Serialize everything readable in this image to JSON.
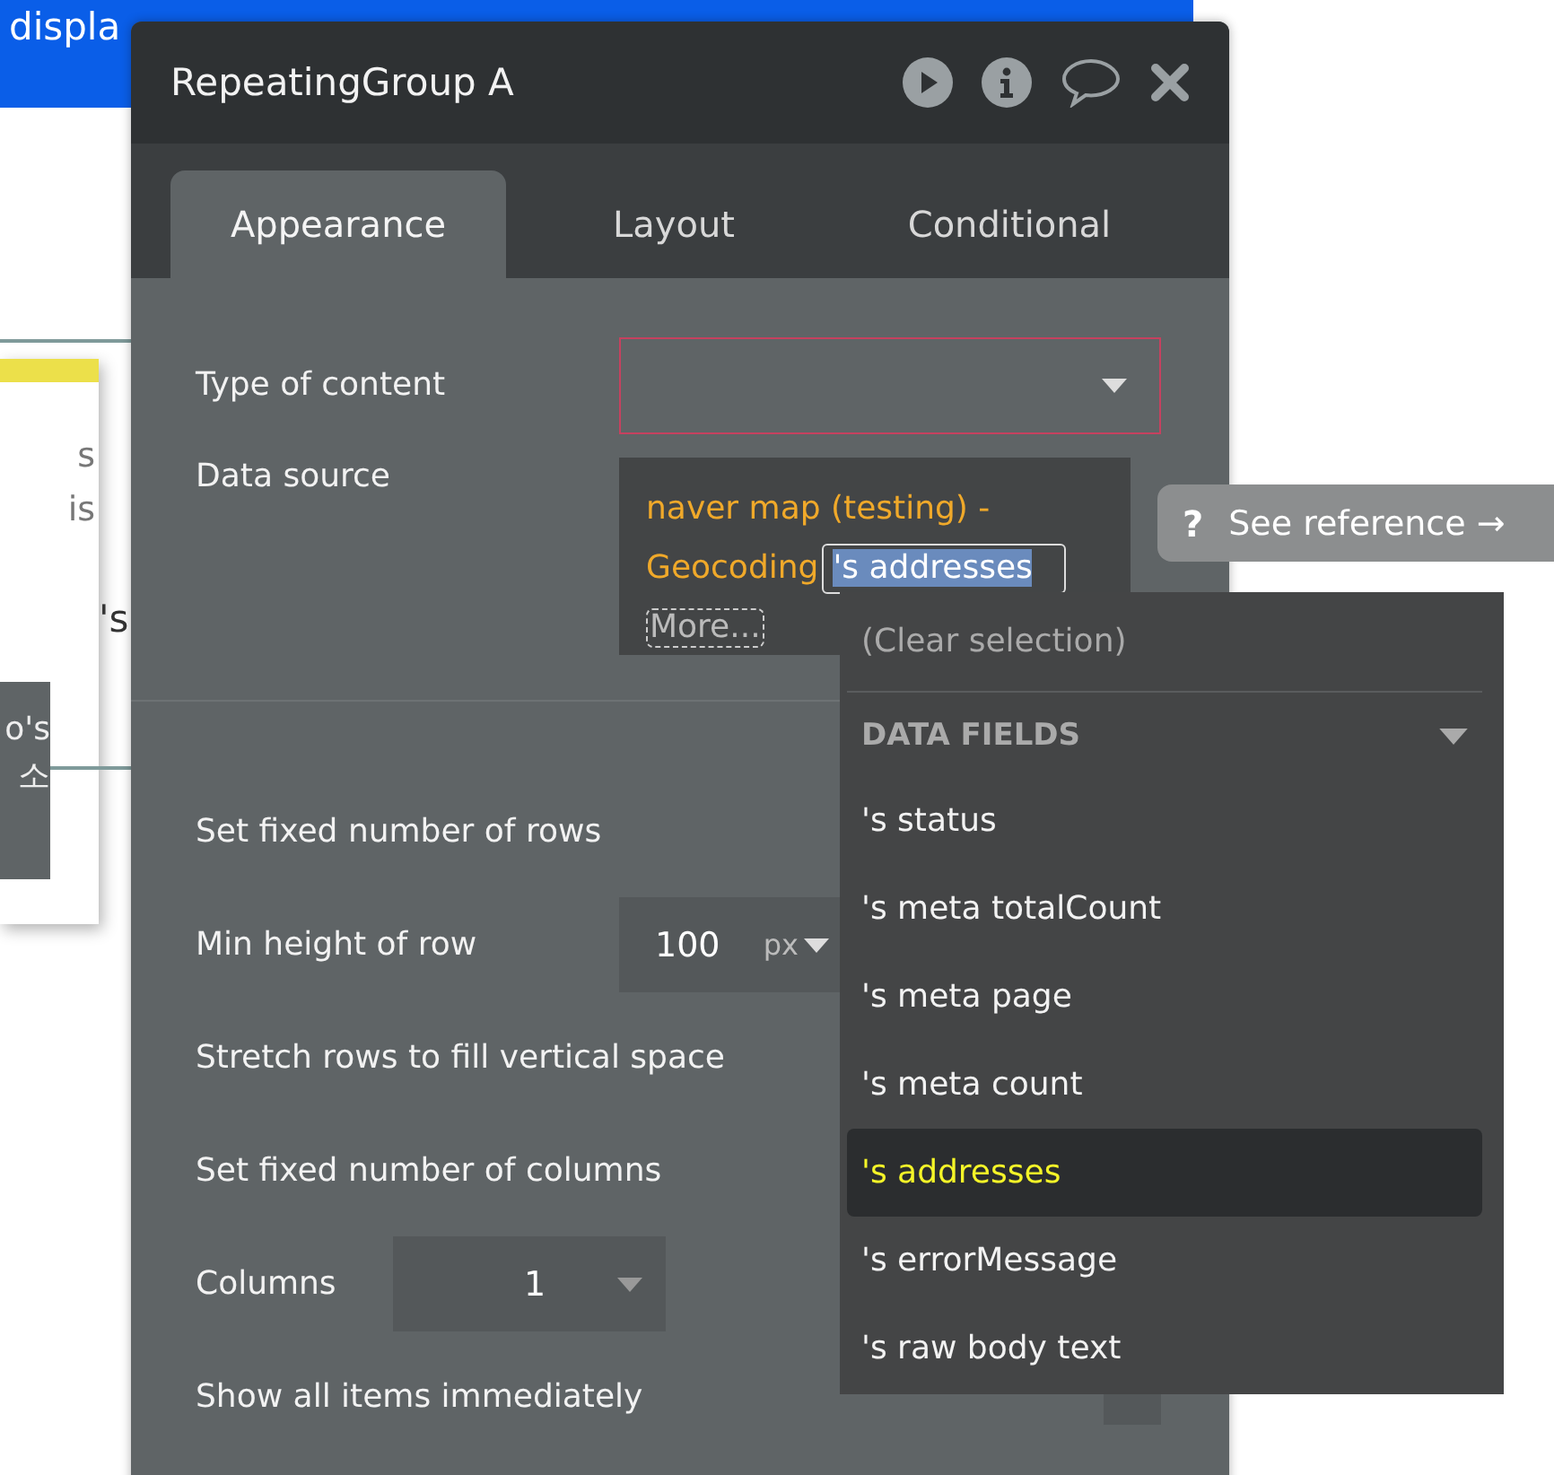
{
  "background": {
    "banner_text": "displa",
    "card_texts": [
      "s",
      "is"
    ],
    "page_text": "'s",
    "dark_box_texts": [
      "o's",
      "소"
    ]
  },
  "panel": {
    "title": "RepeatingGroup A",
    "tabs": [
      {
        "label": "Appearance",
        "selected": true
      },
      {
        "label": "Layout",
        "selected": false
      },
      {
        "label": "Conditional",
        "selected": false
      }
    ],
    "type_of_content": {
      "label": "Type of content",
      "invalid": true
    },
    "data_source": {
      "label": "Data source",
      "expression": [
        "naver map (testing) -",
        "Geocoding"
      ],
      "selected_field": "'s addresses",
      "more": "More..."
    },
    "rows": [
      {
        "kind": "checkbox",
        "label": "Set fixed number of rows"
      },
      {
        "kind": "size",
        "label": "Min height of row",
        "value": "100",
        "unit": "px"
      },
      {
        "kind": "checkbox",
        "label": "Stretch rows to fill vertical space"
      },
      {
        "kind": "checkbox",
        "label": "Set fixed number of columns"
      },
      {
        "kind": "select",
        "label": "Columns",
        "value": "1"
      },
      {
        "kind": "checkbox",
        "label": "Show all items immediately",
        "checked": false
      }
    ]
  },
  "tooltip": {
    "icon": "?",
    "text": "See reference →"
  },
  "dropdown": {
    "clear": "(Clear selection)",
    "section": "DATA FIELDS",
    "items": [
      {
        "label": "'s status",
        "selected": false
      },
      {
        "label": "'s meta totalCount",
        "selected": false
      },
      {
        "label": "'s meta page",
        "selected": false
      },
      {
        "label": "'s meta count",
        "selected": false
      },
      {
        "label": "'s addresses",
        "selected": true
      },
      {
        "label": "'s errorMessage",
        "selected": false
      },
      {
        "label": "'s raw body text",
        "selected": false
      }
    ]
  }
}
